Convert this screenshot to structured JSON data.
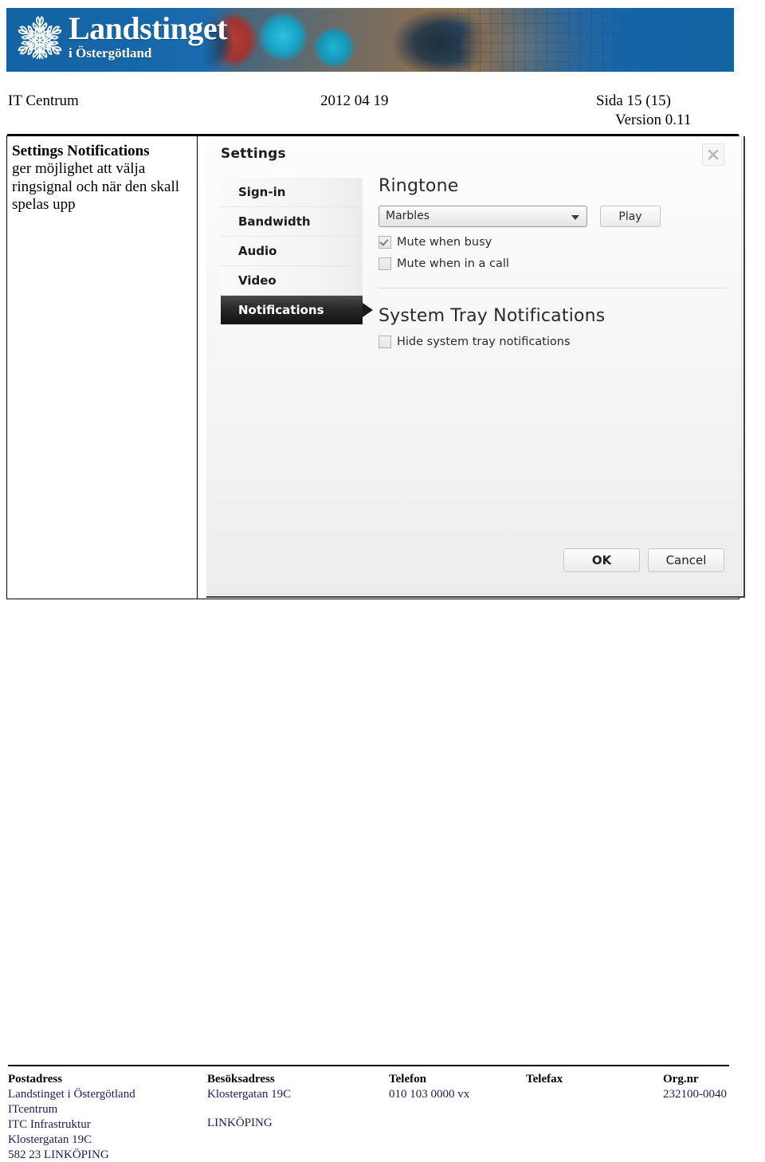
{
  "banner": {
    "logo_icon": "snowflake-tree-logo-icon",
    "title": "Landstinget",
    "subtitle": "i Östergötland"
  },
  "doc_header": {
    "department": "IT Centrum",
    "date": "2012 04 19",
    "page": "Sida 15 (15)",
    "version": "Version 0.11"
  },
  "note": {
    "title": "Settings Notifications",
    "body": "ger möjlighet att välja ringsignal och när den skall spelas upp"
  },
  "dialog": {
    "title": "Settings",
    "close_icon": "close-x-icon",
    "nav": [
      {
        "label": "Sign-in",
        "active": false
      },
      {
        "label": "Bandwidth",
        "active": false
      },
      {
        "label": "Audio",
        "active": false
      },
      {
        "label": "Video",
        "active": false
      },
      {
        "label": "Notifications",
        "active": true
      }
    ],
    "ringtone": {
      "heading": "Ringtone",
      "selected": "Marbles",
      "dropdown_icon": "chevron-down-icon",
      "play_label": "Play",
      "checkboxes": [
        {
          "label": "Mute when busy",
          "checked": true
        },
        {
          "label": "Mute when in a call",
          "checked": false
        }
      ]
    },
    "system_tray": {
      "heading": "System Tray Notifications",
      "checkboxes": [
        {
          "label": "Hide system tray notifications",
          "checked": false
        }
      ]
    },
    "buttons": {
      "ok": "OK",
      "cancel": "Cancel"
    }
  },
  "footer": {
    "columns": [
      {
        "head": "Postadress",
        "lines": [
          "Landstinget i Östergötland",
          "ITcentrum",
          "ITC Infrastruktur",
          "Klostergatan 19C",
          "582 23  LINKÖPING"
        ]
      },
      {
        "head": "Besöksadress",
        "lines": [
          "Klostergatan 19C",
          "",
          "LINKÖPING"
        ]
      },
      {
        "head": "Telefon",
        "lines": [
          "010 103 0000 vx"
        ]
      },
      {
        "head": "Telefax",
        "lines": [
          ""
        ]
      },
      {
        "head": "Org.nr",
        "lines": [
          "232100-0040"
        ]
      }
    ]
  },
  "colors": {
    "brand_blue": "#1464a5",
    "footer_text": "#1b1b5e",
    "nav_active_bg": "#141414"
  }
}
